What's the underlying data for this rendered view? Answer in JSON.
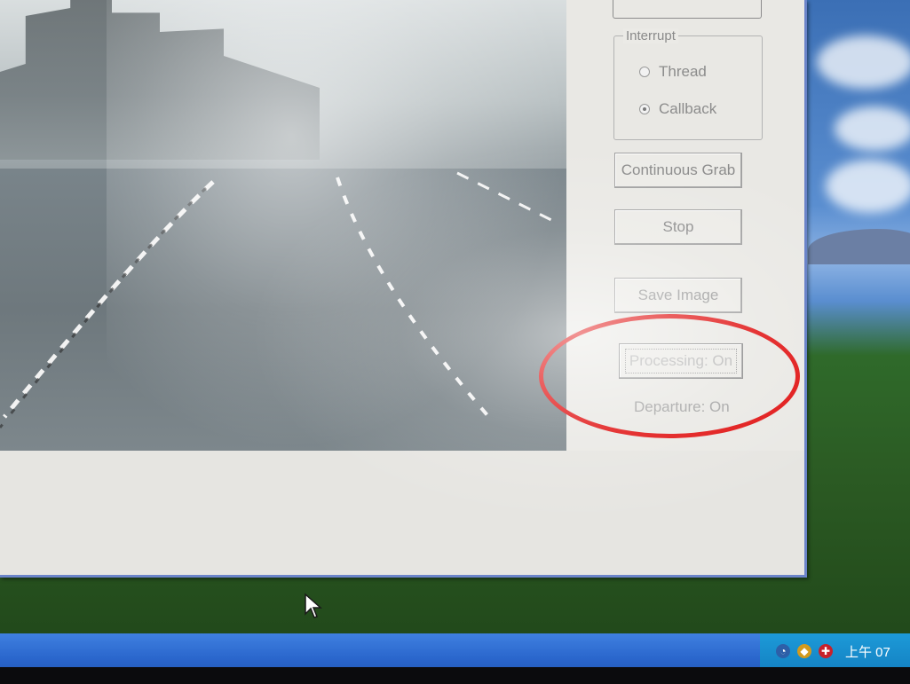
{
  "interrupt_group": {
    "legend": "Interrupt",
    "options": [
      {
        "label": "Thread",
        "selected": false
      },
      {
        "label": "Callback",
        "selected": true
      }
    ]
  },
  "buttons": {
    "continuous_grab": "Continuous Grab",
    "stop": "Stop",
    "save_image": "Save Image",
    "processing": "Processing: On"
  },
  "status": {
    "departure": "Departure: On"
  },
  "taskbar": {
    "clock": "上午 07"
  },
  "colors": {
    "highlight_ring": "#e01010",
    "taskbar": "#2a66cc",
    "tray": "#1483c4"
  },
  "icons": [
    "volume-icon",
    "network-icon",
    "security-shield-icon",
    "mouse-cursor-icon"
  ]
}
